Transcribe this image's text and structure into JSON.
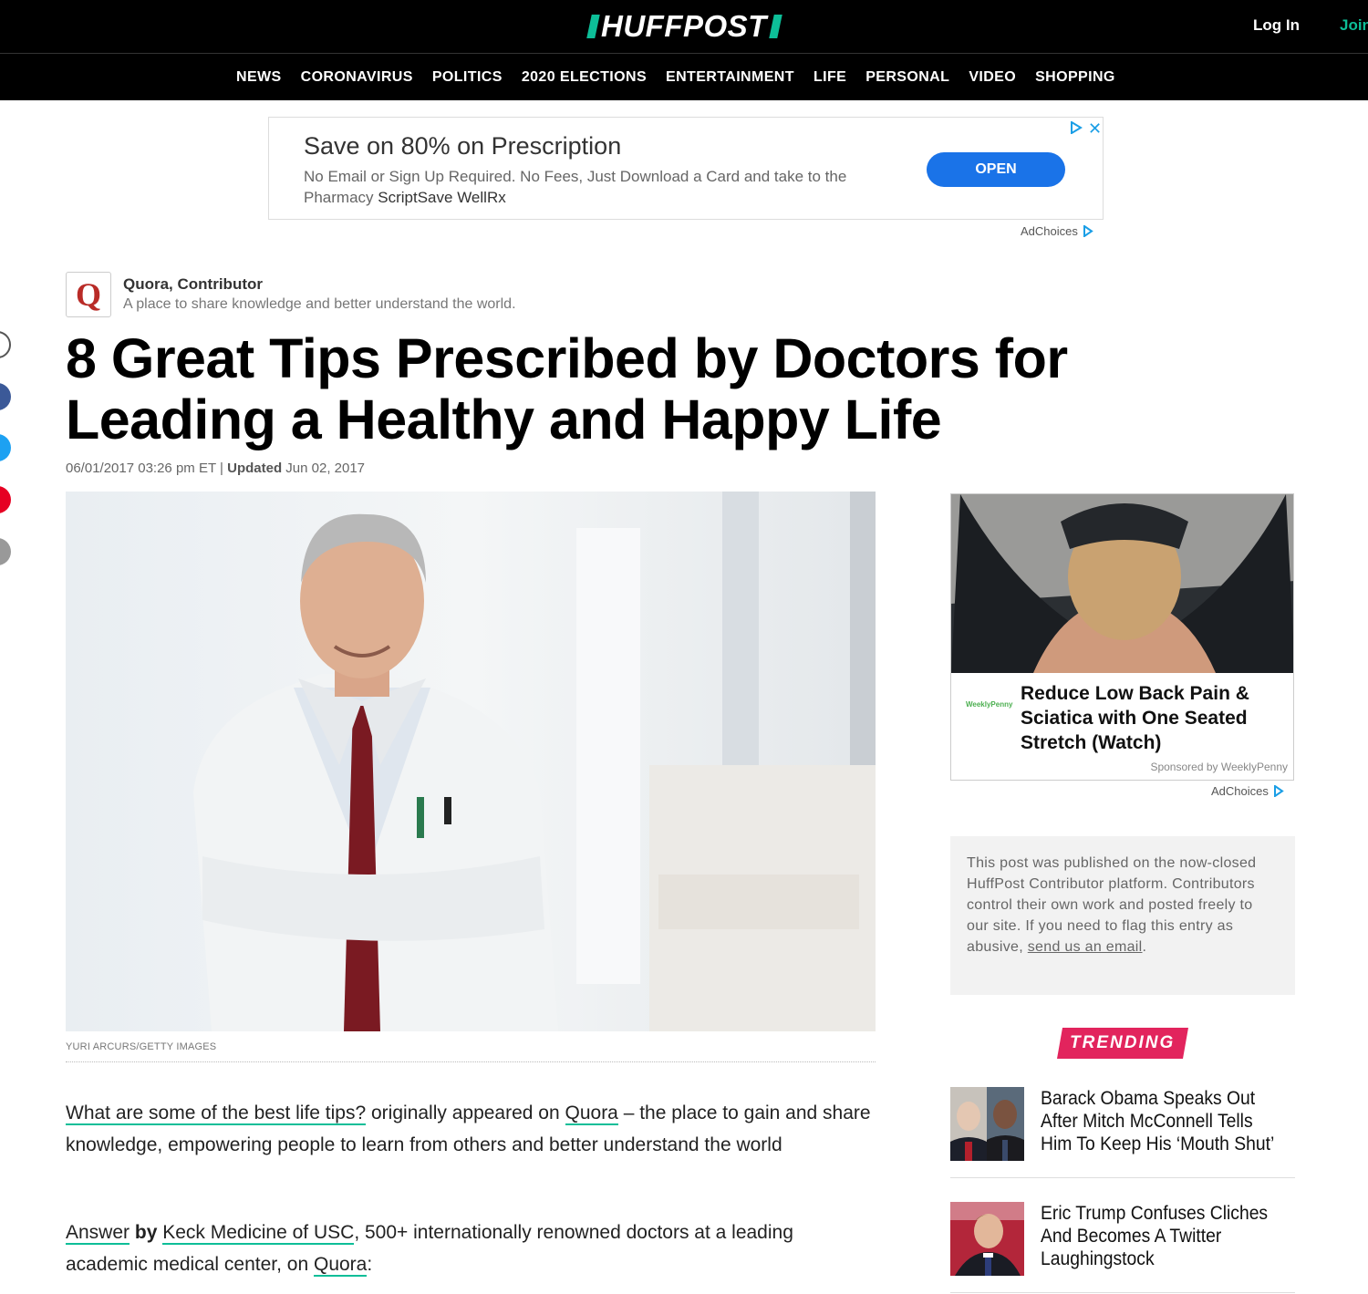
{
  "header": {
    "logo": "HUFFPOST",
    "login_label": "Log In",
    "join_label": "Join",
    "accent_color": "#0dbe98"
  },
  "nav": {
    "items": [
      {
        "label": "NEWS"
      },
      {
        "label": "CORONAVIRUS"
      },
      {
        "label": "POLITICS"
      },
      {
        "label": "2020 ELECTIONS"
      },
      {
        "label": "ENTERTAINMENT"
      },
      {
        "label": "LIFE"
      },
      {
        "label": "PERSONAL"
      },
      {
        "label": "VIDEO"
      },
      {
        "label": "SHOPPING"
      }
    ]
  },
  "top_ad": {
    "title": "Save on 80% on Prescription",
    "description": "No Email or Sign Up Required. No Fees, Just Download a Card and take to the Pharmacy",
    "brand": "ScriptSave WellRx",
    "cta_label": "OPEN",
    "adchoices_label": "AdChoices"
  },
  "share_icons": [
    "share-icon",
    "facebook-icon",
    "twitter-icon",
    "pinterest-icon",
    "email-icon"
  ],
  "contributor": {
    "logo_letter": "Q",
    "name": "Quora, Contributor",
    "description": "A place to share knowledge and better understand the world."
  },
  "article": {
    "headline": "8 Great Tips Prescribed by Doctors for Leading a Healthy and Happy Life",
    "published": "06/01/2017 03:26 pm ET",
    "separator": "|",
    "updated_label": "Updated",
    "updated_date": "Jun 02, 2017",
    "image_credit": "YURI ARCURS/GETTY IMAGES",
    "p1_link1": "What are some of the best life tips?",
    "p1_text1": " originally appeared on ",
    "p1_link2": "Quora",
    "p1_text2": " – the place to gain and share knowledge, empowering people to learn from others and better understand the world",
    "p2_link1": "Answer",
    "p2_by": " by ",
    "p2_link2": "Keck Medicine of USC",
    "p2_text1": ", 500+ internationally renowned doctors at a leading academic medical center, on ",
    "p2_link3": "Quora",
    "p2_text2": ":"
  },
  "side_ad": {
    "sponsor_logo": "WeeklyPenny",
    "title": "Reduce Low Back Pain & Sciatica with One Seated Stretch (Watch)",
    "sponsored_by": "Sponsored by WeeklyPenny",
    "adchoices_label": "AdChoices"
  },
  "notice": {
    "text": "This post was published on the now-closed HuffPost Contributor platform. Contributors control their own work and posted freely to our site. If you need to flag this entry as abusive, ",
    "link": "send us an email",
    "end": "."
  },
  "trending": {
    "label": "TRENDING",
    "color": "#e2245d",
    "items": [
      {
        "title": "Barack Obama Speaks Out After Mitch McConnell Tells Him To Keep His ‘Mouth Shut’"
      },
      {
        "title": "Eric Trump Confuses Cliches And Becomes A Twitter Laughingstock"
      }
    ]
  }
}
